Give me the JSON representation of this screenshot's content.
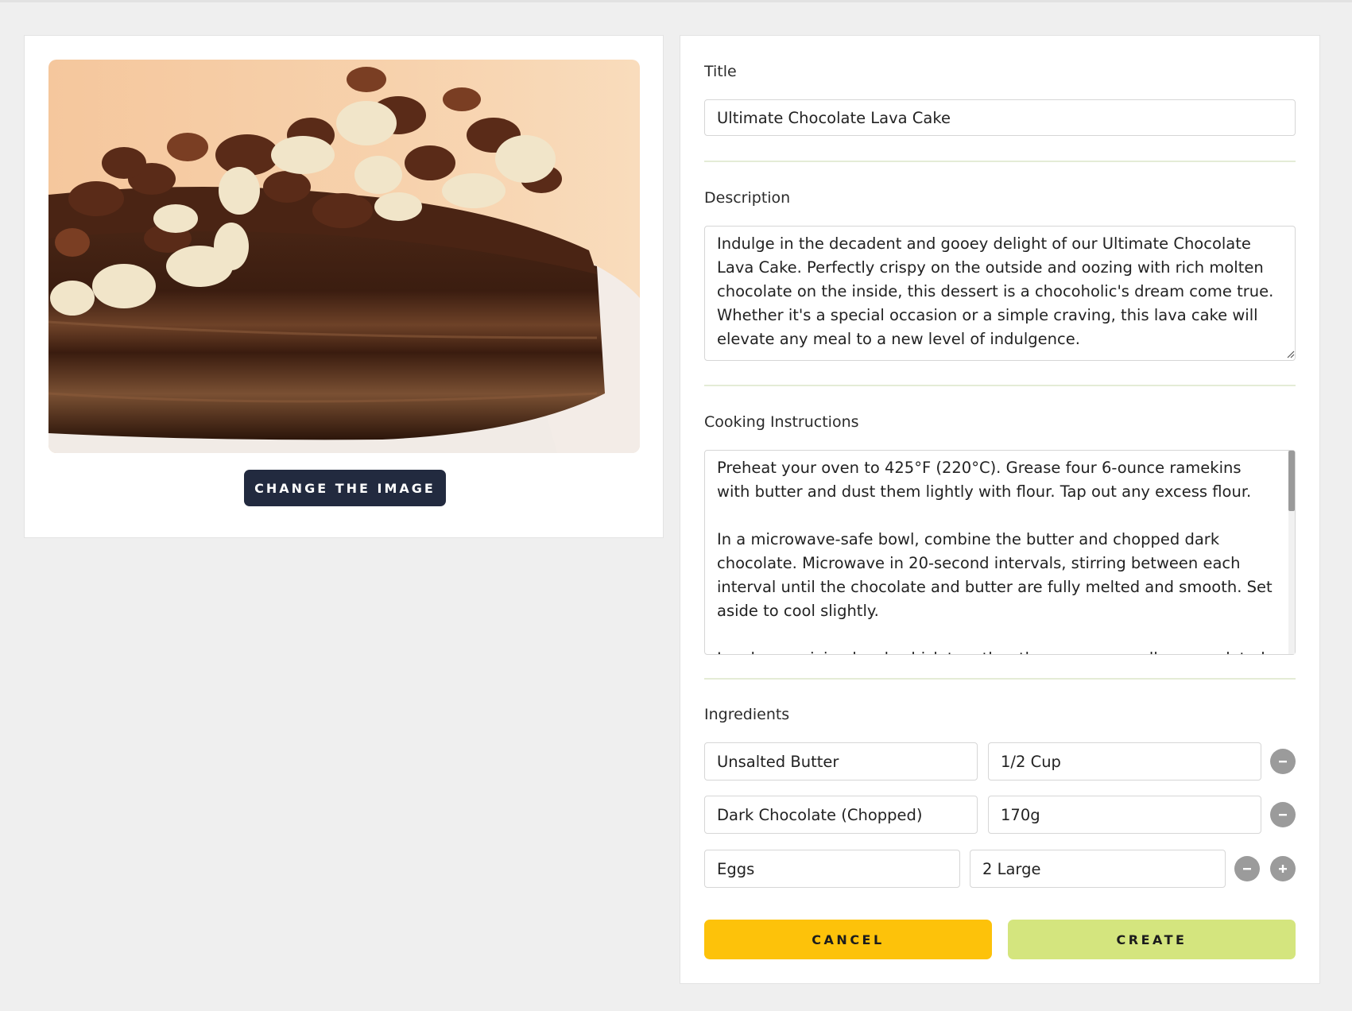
{
  "image_panel": {
    "change_image_label": "CHANGE THE IMAGE"
  },
  "form": {
    "title_label": "Title",
    "title_value": "Ultimate Chocolate Lava Cake",
    "description_label": "Description",
    "description_value": "Indulge in the decadent and gooey delight of our Ultimate Chocolate Lava Cake. Perfectly crispy on the outside and oozing with rich molten chocolate on the inside, this dessert is a chocoholic's dream come true. Whether it's a special occasion or a simple craving, this lava cake will elevate any meal to a new level of indulgence.",
    "instructions_label": "Cooking Instructions",
    "instructions_value": "Preheat your oven to 425°F (220°C). Grease four 6-ounce ramekins with butter and dust them lightly with flour. Tap out any excess flour.\n\nIn a microwave-safe bowl, combine the butter and chopped dark chocolate. Microwave in 20-second intervals, stirring between each interval until the chocolate and butter are fully melted and smooth. Set aside to cool slightly.\n\nIn a large mixing bowl, whisk together the eggs, egg yolks, granulated sugar, salt, and vanilla extract until the mixture is pale and thick.",
    "ingredients_label": "Ingredients",
    "ingredients": [
      {
        "name": "Unsalted Butter",
        "amount": "1/2 Cup"
      },
      {
        "name": "Dark Chocolate (Chopped)",
        "amount": "170g"
      },
      {
        "name": "Eggs",
        "amount": "2 Large"
      }
    ],
    "cancel_label": "CANCEL",
    "create_label": "CREATE"
  },
  "colors": {
    "page_bg": "#efefef",
    "dark_button": "#222a3f",
    "cancel_button": "#fdc20a",
    "create_button": "#d4e57e",
    "divider": "#e4ecd6",
    "circle_button": "#9b9b9b"
  }
}
